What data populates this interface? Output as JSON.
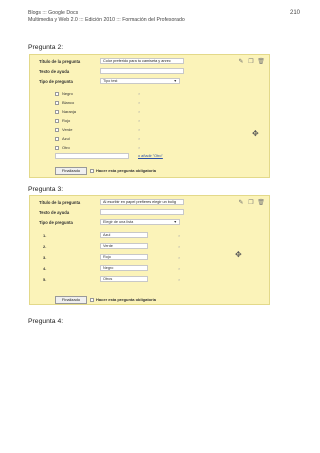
{
  "header": {
    "line1": "Blogs ::: Google Docs",
    "line2": "Multimedia y Web 2.0 ::: Edición 2010 ::: Formación del Profesorado",
    "page_number": "210"
  },
  "question2": {
    "heading": "Pregunta 2:",
    "title_label": "Título de la pregunta",
    "title_value": "Color preferido para tu camiseta y anrec",
    "help_label": "Texto de ayuda",
    "type_label": "Tipo de pregunta",
    "type_value": "Tipo test",
    "options": [
      "Negro",
      "Blanco",
      "Naranja",
      "Rojo",
      "Verde",
      "Azul",
      "Otro"
    ],
    "add_other": "o añadir \"Otro\"",
    "done_label": "Finalizado",
    "required_label": "Hacer esta pregunta obligatoria"
  },
  "question3": {
    "heading": "Pregunta 3:",
    "title_label": "Título de la pregunta",
    "title_value": "Al escribir en papel prefieres elegir un bolíg",
    "help_label": "Texto de ayuda",
    "type_label": "Tipo de pregunta",
    "type_value": "Elegir de una lista",
    "numbers": [
      "1.",
      "2.",
      "3.",
      "4.",
      "5."
    ],
    "options": [
      "Azul",
      "Verde",
      "Rojo",
      "Negro",
      "Otros"
    ],
    "done_label": "Finalizado",
    "required_label": "Hacer esta pregunta obligatoria"
  },
  "question4": {
    "heading": "Pregunta 4:"
  },
  "icons": {
    "edit": "pencil-icon",
    "copy": "copy-icon",
    "delete": "trash-icon",
    "move": "move-icon",
    "remove": "x-icon"
  }
}
